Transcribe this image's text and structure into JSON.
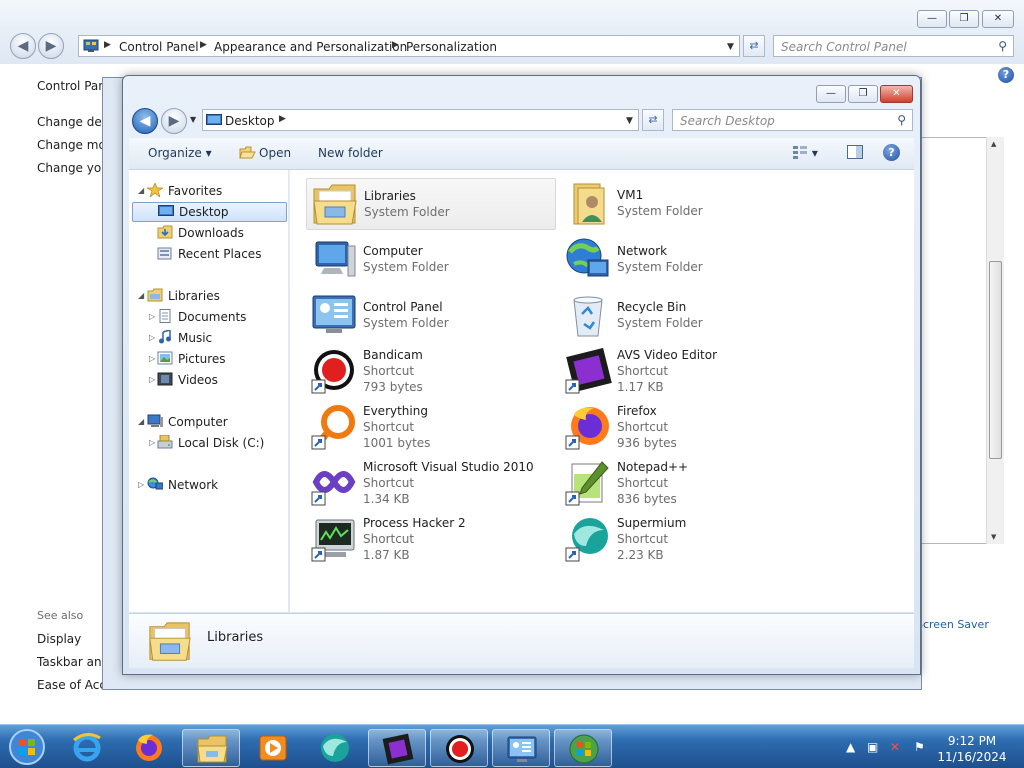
{
  "control_panel": {
    "breadcrumb": [
      "Control Panel",
      "Appearance and Personalization",
      "Personalization"
    ],
    "search_placeholder": "Search Control Panel",
    "sidebar": {
      "home_label": "Control Panel Home",
      "tasks": [
        "Change desktop icons",
        "Change mouse pointers",
        "Change your account picture"
      ],
      "see_also": "See also",
      "see_also_links": [
        "Display",
        "Taskbar and Start Menu",
        "Ease of Access Center"
      ]
    },
    "screen_saver_link": "Screen Saver"
  },
  "explorer": {
    "address": "Desktop",
    "search_placeholder": "Search Desktop",
    "toolbar": {
      "organize": "Organize",
      "open": "Open",
      "new_folder": "New folder"
    },
    "nav": {
      "favorites": "Favorites",
      "desktop": "Desktop",
      "downloads": "Downloads",
      "recent_places": "Recent Places",
      "libraries": "Libraries",
      "documents": "Documents",
      "music": "Music",
      "pictures": "Pictures",
      "videos": "Videos",
      "computer": "Computer",
      "local_disk": "Local Disk (C:)",
      "network": "Network"
    },
    "files": [
      {
        "name": "Libraries",
        "type": "System Folder",
        "size": ""
      },
      {
        "name": "VM1",
        "type": "System Folder",
        "size": ""
      },
      {
        "name": "Computer",
        "type": "System Folder",
        "size": ""
      },
      {
        "name": "Network",
        "type": "System Folder",
        "size": ""
      },
      {
        "name": "Control Panel",
        "type": "System Folder",
        "size": ""
      },
      {
        "name": "Recycle Bin",
        "type": "System Folder",
        "size": ""
      },
      {
        "name": "Bandicam",
        "type": "Shortcut",
        "size": "793 bytes"
      },
      {
        "name": "AVS Video Editor",
        "type": "Shortcut",
        "size": "1.17 KB"
      },
      {
        "name": "Everything",
        "type": "Shortcut",
        "size": "1001 bytes"
      },
      {
        "name": "Firefox",
        "type": "Shortcut",
        "size": "936 bytes"
      },
      {
        "name": "Microsoft Visual Studio 2010",
        "type": "Shortcut",
        "size": "1.34 KB"
      },
      {
        "name": "Notepad++",
        "type": "Shortcut",
        "size": "836 bytes"
      },
      {
        "name": "Process Hacker 2",
        "type": "Shortcut",
        "size": "1.87 KB"
      },
      {
        "name": "Supermium",
        "type": "Shortcut",
        "size": "2.23 KB"
      }
    ],
    "details_name": "Libraries"
  },
  "taskbar": {
    "time": "9:12 PM",
    "date": "11/16/2024",
    "apps": [
      "start-orb",
      "internet-explorer-icon",
      "firefox-icon",
      "explorer-icon",
      "media-player-icon",
      "supermium-icon",
      "avs-video-editor-icon",
      "bandicam-icon",
      "control-panel-icon",
      "windows-logo-icon"
    ]
  },
  "colors": {
    "taskbar_top": "#5f9fd9",
    "taskbar_bottom": "#1f4f8d",
    "selection": "#cfe3fb",
    "link": "#1f5eab"
  }
}
